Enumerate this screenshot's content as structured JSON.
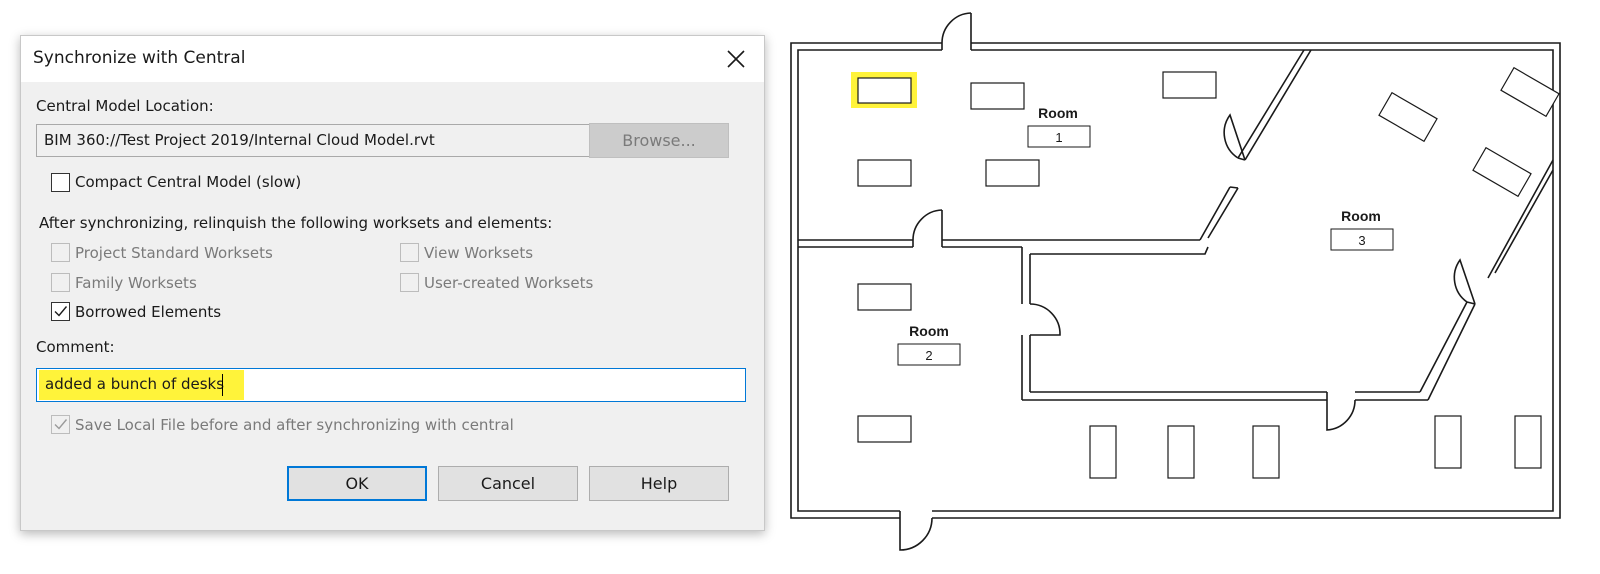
{
  "dialog": {
    "title": "Synchronize with Central",
    "central_model_label": "Central Model Location:",
    "central_model_path": "BIM 360://Test Project 2019/Internal Cloud Model.rvt",
    "browse_label": "Browse...",
    "compact_label": "Compact Central Model (slow)",
    "compact_checked": false,
    "relinquish_heading": "After synchronizing, relinquish the following worksets and elements:",
    "relinquish_options": [
      {
        "label": "Project Standard Worksets",
        "checked": false,
        "enabled": false
      },
      {
        "label": "View Worksets",
        "checked": false,
        "enabled": false
      },
      {
        "label": "Family Worksets",
        "checked": false,
        "enabled": false
      },
      {
        "label": "User-created Worksets",
        "checked": false,
        "enabled": false
      },
      {
        "label": "Borrowed Elements",
        "checked": true,
        "enabled": true
      }
    ],
    "comment_label": "Comment:",
    "comment_value": "added a bunch of desks",
    "save_local_label": "Save Local File before and after synchronizing with central",
    "save_local_checked": true,
    "ok_label": "OK",
    "cancel_label": "Cancel",
    "help_label": "Help"
  },
  "floorplan": {
    "rooms": [
      {
        "name": "Room",
        "number": "1"
      },
      {
        "name": "Room",
        "number": "2"
      },
      {
        "name": "Room",
        "number": "3"
      }
    ],
    "highlight_color": "#fff33a"
  },
  "colors": {
    "accent": "#0078d7",
    "highlight": "#fff33a",
    "dialog_bg": "#f0f0f0"
  }
}
